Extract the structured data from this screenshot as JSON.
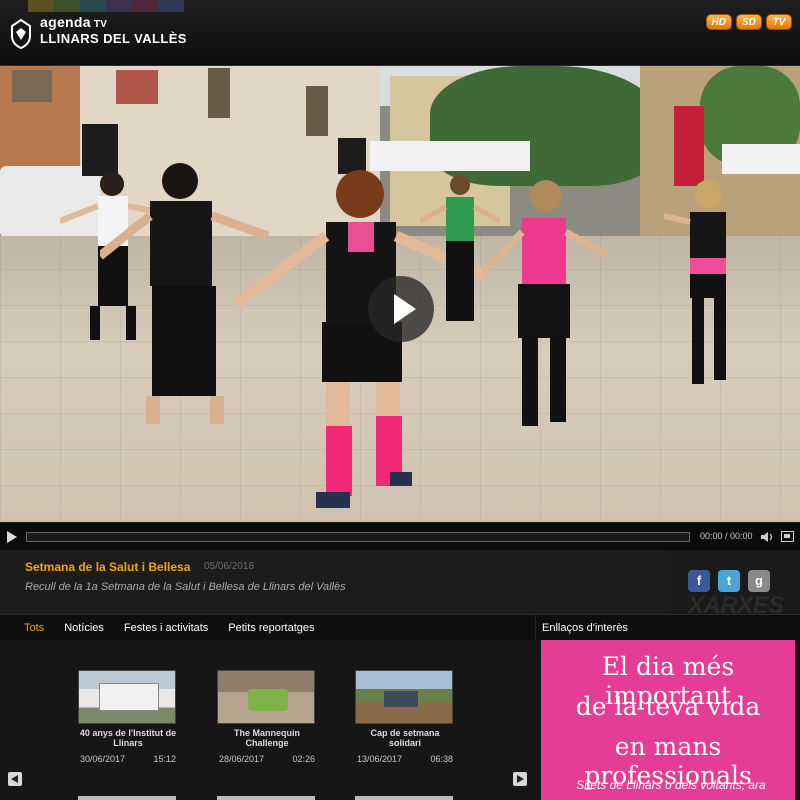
{
  "header": {
    "brand_top": "agenda",
    "brand_top_suffix": "TV",
    "brand_bottom": "LLINARS DEL VALLÈS",
    "strip_colors": [
      "#8a7c2a",
      "#5a7a2f",
      "#2f6f7a",
      "#5a3f7a",
      "#7a2f4f",
      "#3f4f8a"
    ],
    "quality_buttons": [
      "HD",
      "SD",
      "TV"
    ]
  },
  "player": {
    "time_display": "00:00 / 00:00",
    "progress": 0
  },
  "video_info": {
    "title": "Setmana de la Salut i Bellesa",
    "date": "05/06/2018",
    "description": "Recull de la 1a Setmana de la Salut i Bellesa de Llinars del Vallès"
  },
  "social": {
    "label": "XARXES",
    "buttons": [
      {
        "icon": "facebook-icon",
        "glyph": "f",
        "color": "#3b5998"
      },
      {
        "icon": "twitter-icon",
        "glyph": "t",
        "color": "#4aa6d6"
      },
      {
        "icon": "google-plus-icon",
        "glyph": "g",
        "color": "#8a8a8a"
      }
    ]
  },
  "tabs": [
    {
      "label": "Tots",
      "active": true
    },
    {
      "label": "Notícies",
      "active": false
    },
    {
      "label": "Festes i activitats",
      "active": false
    },
    {
      "label": "Petits reportatges",
      "active": false
    }
  ],
  "links_heading": "Enllaços d'interès",
  "gallery": {
    "items": [
      {
        "title": "40 anys de l'Institut de Llinars",
        "date": "30/06/2017",
        "duration": "15:12"
      },
      {
        "title": "The Mannequin Challenge",
        "date": "28/06/2017",
        "duration": "02:26"
      },
      {
        "title": "Cap de setmana solidari",
        "date": "13/06/2017",
        "duration": "06:38"
      }
    ]
  },
  "ad": {
    "lines": [
      "El dia més important",
      "de la teva vida",
      "en mans professionals"
    ],
    "subtext": "Si ets de Llinars o dels voltants, ara",
    "subtext2": "...",
    "background": "#e53c95"
  }
}
